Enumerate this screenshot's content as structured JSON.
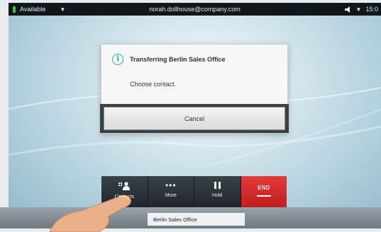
{
  "status_bar": {
    "presence": "Available",
    "account": "norah.dollhouse@company.com",
    "time": "15:0"
  },
  "dialog": {
    "title": "Transferring Berlin Sales Office",
    "message": "Choose contact.",
    "cancel_label": "Cancel"
  },
  "call_controls": {
    "contacts_label": "Contacts",
    "more_label": "More",
    "hold_label": "Hold",
    "end_label": "END"
  },
  "active_call": {
    "name": "Berlin Sales Office"
  },
  "colors": {
    "accent": "#27a7c9",
    "end": "#d42b2b",
    "presence": "#47c23a"
  }
}
